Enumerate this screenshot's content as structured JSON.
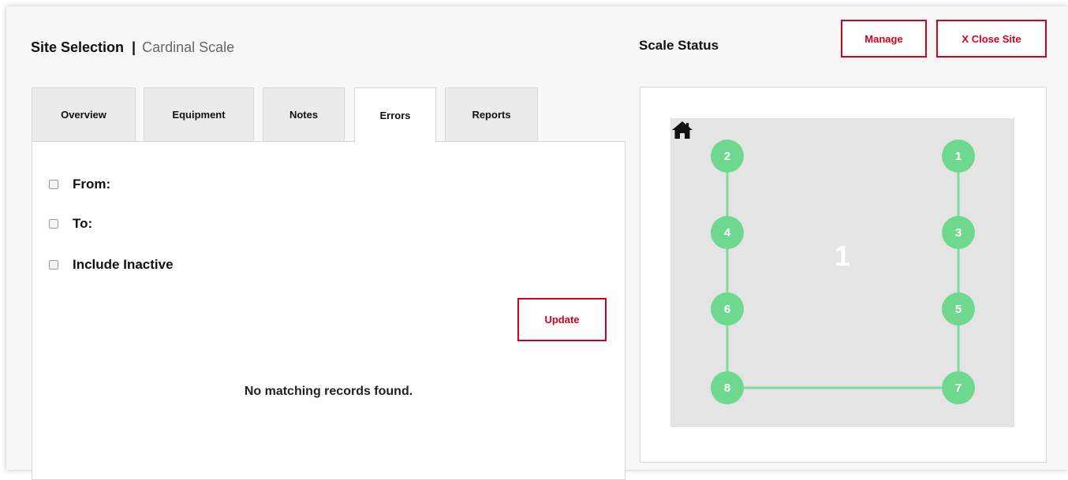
{
  "header": {
    "title": "Site Selection",
    "separator": "|",
    "subtitle": "Cardinal Scale"
  },
  "status": {
    "title": "Scale Status"
  },
  "buttons": {
    "manage": "Manage",
    "close_site": "X Close Site",
    "update": "Update"
  },
  "tabs": [
    {
      "label": "Overview"
    },
    {
      "label": "Equipment"
    },
    {
      "label": "Notes"
    },
    {
      "label": "Errors",
      "active": true
    },
    {
      "label": "Reports"
    }
  ],
  "filters": {
    "from": "From:",
    "to": "To:",
    "include_inactive": "Include Inactive"
  },
  "empty_message": "No matching records found.",
  "scale_diagram": {
    "scale_number": "1",
    "load_cells": [
      "1",
      "2",
      "3",
      "4",
      "5",
      "6",
      "7",
      "8"
    ],
    "node_color": "#6fd88f",
    "line_color": "#7fdc9c",
    "background": "#e4e4e4",
    "home_icon": "home-icon"
  },
  "colors": {
    "accent": "#d0021b"
  }
}
